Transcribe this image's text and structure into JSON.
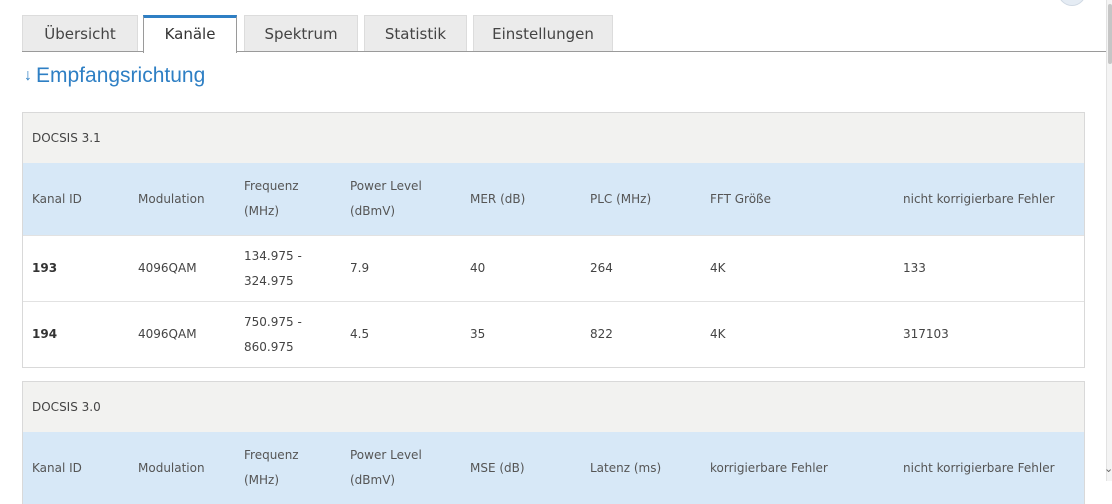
{
  "tabs": [
    {
      "label": "Übersicht",
      "active": false
    },
    {
      "label": "Kanäle",
      "active": true
    },
    {
      "label": "Spektrum",
      "active": false
    },
    {
      "label": "Statistik",
      "active": false
    },
    {
      "label": "Einstellungen",
      "active": false
    }
  ],
  "section": {
    "arrow": "↓",
    "title": "Empfangsrichtung"
  },
  "docsis31": {
    "caption": "DOCSIS 3.1",
    "headers": [
      "Kanal ID",
      "Modulation",
      "Frequenz\n(MHz)",
      "Power Level\n(dBmV)",
      "MER (dB)",
      "PLC (MHz)",
      "FFT Größe",
      "nicht korrigierbare Fehler"
    ],
    "rows": [
      [
        "193",
        "4096QAM",
        "134.975 -\n324.975",
        "7.9",
        "40",
        "264",
        "4K",
        "133"
      ],
      [
        "194",
        "4096QAM",
        "750.975 -\n860.975",
        "4.5",
        "35",
        "822",
        "4K",
        "317103"
      ]
    ]
  },
  "docsis30": {
    "caption": "DOCSIS 3.0",
    "headers": [
      "Kanal ID",
      "Modulation",
      "Frequenz\n(MHz)",
      "Power Level\n(dBmV)",
      "MSE (dB)",
      "Latenz (ms)",
      "korrigierbare Fehler",
      "nicht korrigierbare Fehler"
    ]
  },
  "colors": {
    "accent": "#2e7fc4",
    "header_bg": "#d7e8f7",
    "caption_bg": "#f2f2f0"
  }
}
